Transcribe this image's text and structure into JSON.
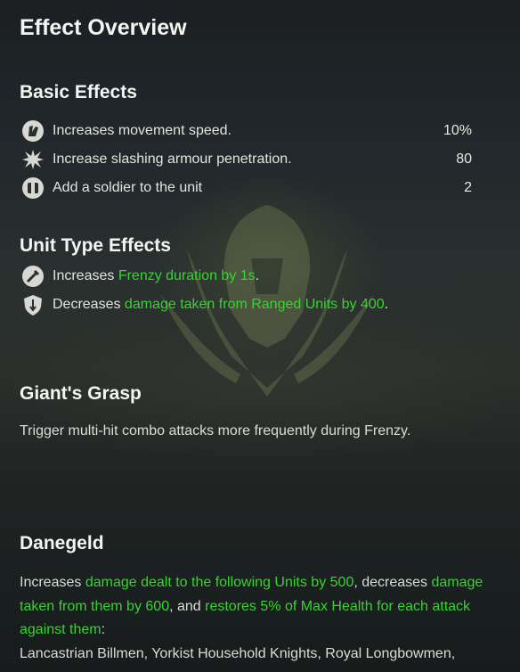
{
  "title": "Effect Overview",
  "basic": {
    "heading": "Basic Effects",
    "items": [
      {
        "icon": "boot-icon",
        "label": "Increases movement speed.",
        "value": "10%"
      },
      {
        "icon": "slash-burst-icon",
        "label": "Increase slashing armour penetration.",
        "value": "80"
      },
      {
        "icon": "soldier-icon",
        "label": "Add a soldier to the unit",
        "value": "2"
      }
    ]
  },
  "unit_type": {
    "heading": "Unit Type Effects",
    "items": [
      {
        "icon": "frenzy-icon",
        "prefix": "Increases ",
        "highlight": "Frenzy duration by 1s",
        "suffix": "."
      },
      {
        "icon": "shield-arrow-icon",
        "prefix": "Decreases ",
        "highlight": "damage taken from Ranged Units by 400",
        "suffix": "."
      }
    ]
  },
  "giants_grasp": {
    "heading": "Giant's Grasp",
    "text": "Trigger multi-hit combo attacks more frequently during Frenzy."
  },
  "danegeld": {
    "heading": "Danegeld",
    "p1": "Increases ",
    "g1": "damage dealt to the following Units by 500",
    "p2": ", decreases ",
    "g2": "damage taken from them by 600",
    "p3": ", and ",
    "g3": "restores 5% of Max Health for each attack against them",
    "p4": ":",
    "units": "Lancastrian Billmen, Yorkist Household Knights, Royal Longbowmen,"
  },
  "colors": {
    "highlight": "#37d431",
    "heading": "#f4f4f0",
    "text": "#e4e4de"
  }
}
